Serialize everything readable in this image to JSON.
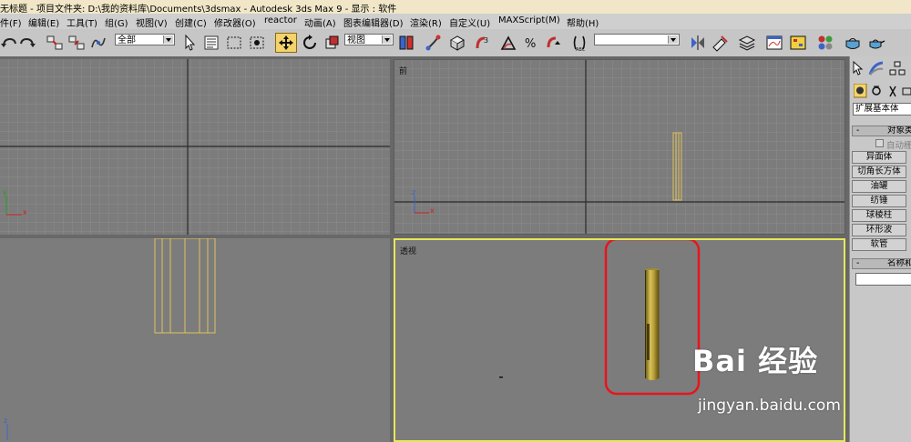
{
  "window": {
    "title": "无标题    - 项目文件夹: D:\\我的资料库\\Documents\\3dsmax    - Autodesk 3ds Max 9    - 显示 : 软件"
  },
  "menu": {
    "items": [
      "件(F)",
      "编辑(E)",
      "工具(T)",
      "组(G)",
      "视图(V)",
      "创建(C)",
      "修改器(O)",
      "reactor",
      "动画(A)",
      "图表编辑器(D)",
      "渲染(R)",
      "自定义(U)",
      "MAXScript(M)",
      "帮助(H)"
    ]
  },
  "toolbar": {
    "selection_filter": "全部",
    "reference_coord": "视图",
    "named_selection": "",
    "active_tool": "move"
  },
  "viewports": {
    "top_label": "",
    "front_label": "前",
    "left_label": "",
    "persp_label": "透视",
    "active_border_color": "#e7e75a",
    "object_wire_color": "#e0c25a",
    "highlight_color": "#e8141e",
    "axis_x": "x",
    "axis_y": "y",
    "axis_z": "z"
  },
  "command_panel": {
    "category": "扩展基本体",
    "rollout_object_type": "对象类",
    "auto_grid": "自动栅",
    "buttons": [
      "异面体",
      "切角长方体",
      "油罐",
      "纺锤",
      "球棱柱",
      "环形波",
      "软管"
    ],
    "rollout_name": "名称和"
  },
  "watermark": {
    "logo": "Bai 经验",
    "url": "jingyan.baidu.com"
  }
}
